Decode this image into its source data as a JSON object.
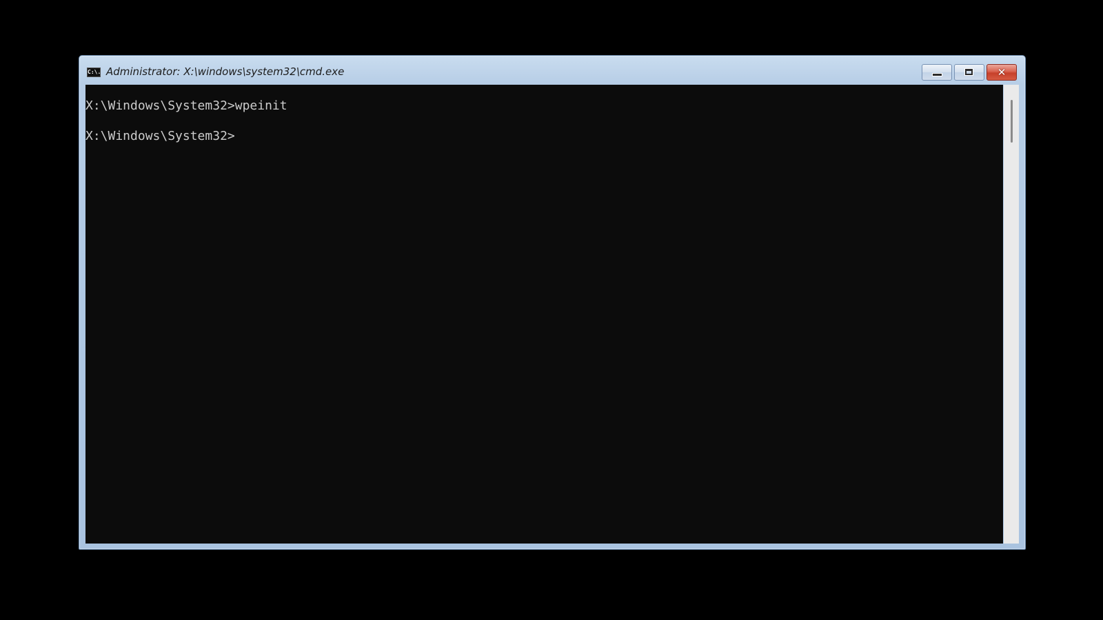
{
  "window": {
    "title": "Administrator: X:\\windows\\system32\\cmd.exe",
    "icon": "cmd-icon",
    "icon_text": "C:\\."
  },
  "console": {
    "lines": [
      "X:\\Windows\\System32>wpeinit",
      "",
      "X:\\Windows\\System32>"
    ]
  },
  "caption_buttons": {
    "minimize": "minimize-icon",
    "maximize": "maximize-icon",
    "close": "close-icon",
    "close_glyph": "✕"
  },
  "colors": {
    "console_bg": "#0c0c0c",
    "console_text": "#cccccc",
    "frame": "#b6cde6",
    "close_button": "#c6402a"
  }
}
